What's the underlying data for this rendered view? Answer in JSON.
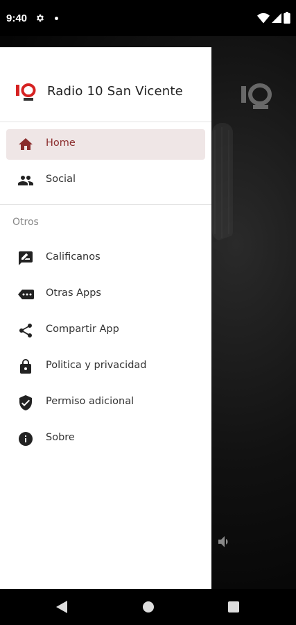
{
  "status_bar": {
    "time": "9:40"
  },
  "drawer": {
    "brand_name": "Radio 10 San Vicente",
    "primary_items": [
      {
        "label": "Home",
        "icon": "home-icon",
        "active": true
      },
      {
        "label": "Social",
        "icon": "people-icon",
        "active": false
      }
    ],
    "section_header": "Otros",
    "secondary_items": [
      {
        "label": "Calificanos",
        "icon": "rate-review-icon"
      },
      {
        "label": "Otras Apps",
        "icon": "more-apps-icon"
      },
      {
        "label": "Compartir App",
        "icon": "share-icon"
      },
      {
        "label": "Politica y privacidad",
        "icon": "lock-icon"
      },
      {
        "label": "Permiso adicional",
        "icon": "verified-shield-icon"
      },
      {
        "label": "Sobre",
        "icon": "info-icon"
      }
    ]
  },
  "colors": {
    "accent": "#8b2d2d",
    "active_bg": "#efe6e6",
    "brand_red": "#d62222"
  }
}
